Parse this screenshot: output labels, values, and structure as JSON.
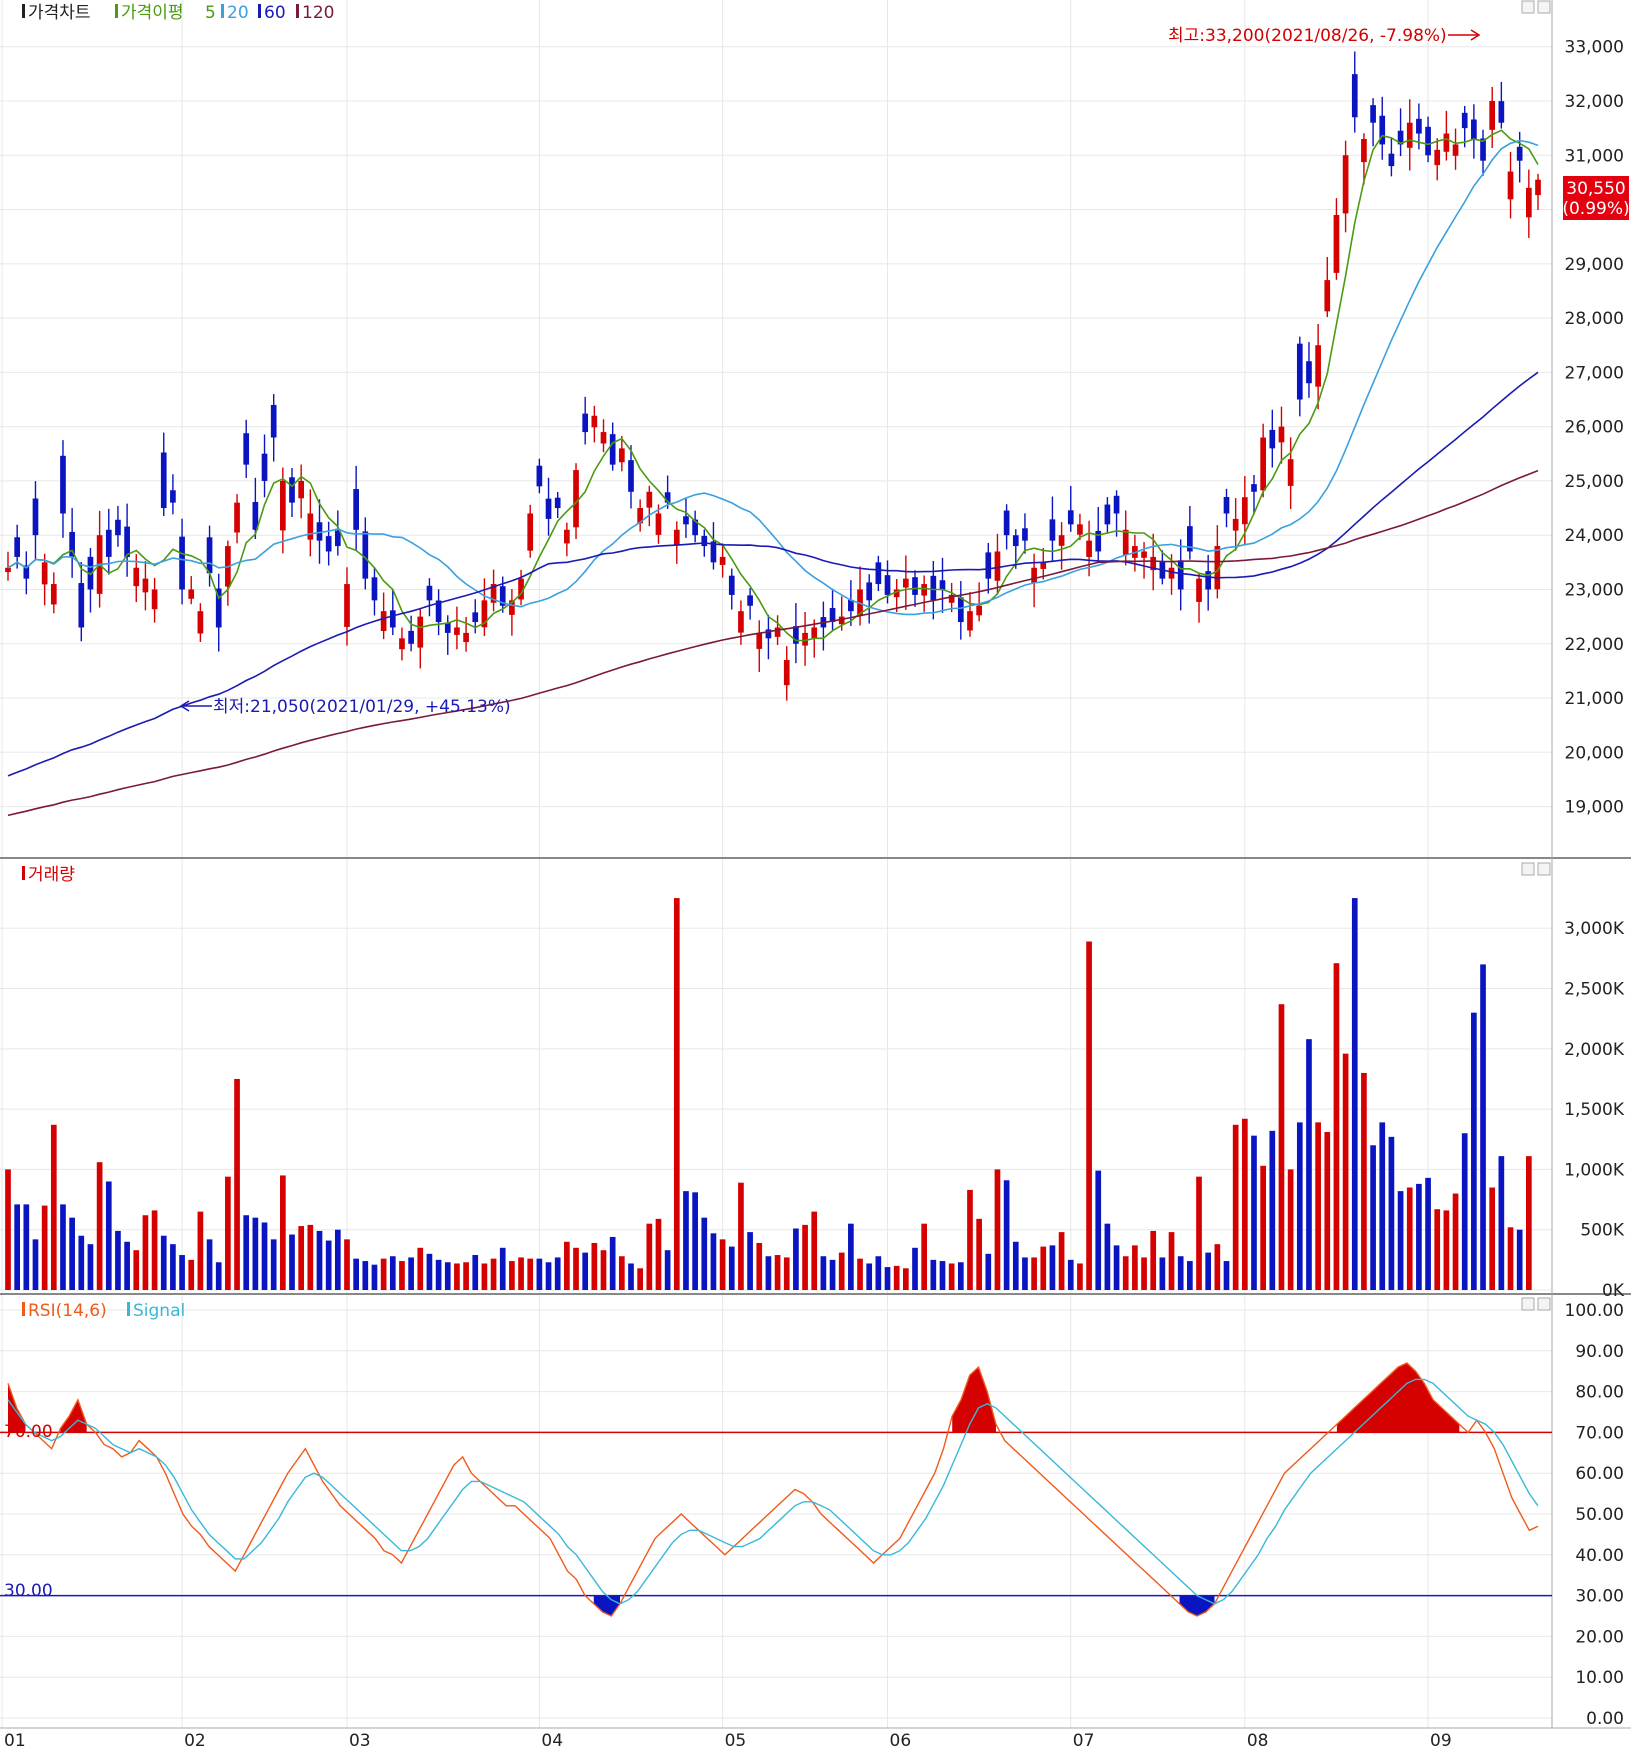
{
  "price_panel": {
    "legend": {
      "price_chart": "가격차트",
      "ma_label": "가격이평",
      "ma5": "5",
      "ma20": "20",
      "ma60": "60",
      "ma120": "120"
    },
    "annotations": {
      "high": "최고:33,200(2021/08/26, -7.98%)",
      "low": "최저:21,050(2021/01/29, +45.13%)"
    },
    "current_price": "30,550",
    "current_change": "(0.99%)"
  },
  "volume_panel": {
    "legend": "거래량"
  },
  "rsi_panel": {
    "legend": "RSI(14,6)",
    "signal_legend": "Signal",
    "upper_label": "70.00",
    "lower_label": "30.00"
  },
  "colors": {
    "up": "#d50000",
    "down": "#0a14c0",
    "ma5": "#4b9a12",
    "ma20": "#3aa0e0",
    "ma60": "#1a1ab4",
    "ma120": "#7a1a3a",
    "rsi": "#f05a1a",
    "signal": "#38b8d8"
  },
  "chart_data": [
    {
      "type": "candlestick",
      "title": "가격차트",
      "x_ticks": [
        "01",
        "02",
        "03",
        "04",
        "05",
        "06",
        "07",
        "08",
        "09"
      ],
      "y_ticks": [
        "19,000",
        "20,000",
        "21,000",
        "22,000",
        "23,000",
        "24,000",
        "25,000",
        "26,000",
        "27,000",
        "28,000",
        "29,000",
        "30,000",
        "31,000",
        "32,000",
        "33,000"
      ],
      "ylim": [
        18200,
        33400
      ],
      "high": 33200,
      "low": 21050,
      "close_last": 30550,
      "close": [
        23400,
        23600,
        23200,
        24000,
        23500,
        23100,
        24400,
        23600,
        22300,
        23000,
        24000,
        23600,
        24000,
        23600,
        23400,
        23200,
        23000,
        24500,
        24600,
        23000,
        23000,
        22600,
        23300,
        22300,
        23800,
        24600,
        25300,
        24100,
        25000,
        25800,
        25000,
        24600,
        25000,
        24400,
        23900,
        23700,
        23800,
        23100,
        24100,
        23200,
        22800,
        22600,
        22300,
        22100,
        22000,
        22500,
        22800,
        22400,
        22200,
        22300,
        22200,
        22400,
        22800,
        23100,
        22700,
        22800,
        23200,
        24400,
        24900,
        24300,
        24500,
        24100,
        25200,
        25900,
        26200,
        25900,
        25300,
        25600,
        24800,
        24500,
        24800,
        24400,
        24600,
        24100,
        24200,
        24000,
        23800,
        23500,
        23600,
        22900,
        22600,
        22700,
        22200,
        22100,
        22300,
        21700,
        22000,
        22200,
        22300,
        22300,
        22400,
        22500,
        22600,
        23000,
        22800,
        23100,
        22900,
        23000,
        23200,
        22900,
        23100,
        22800,
        23000,
        22900,
        22400,
        22600,
        22700,
        23200,
        23700,
        24000,
        23800,
        23900,
        23400,
        23500,
        23900,
        24000,
        24200,
        24200,
        23900,
        23700,
        24200,
        24400,
        24100,
        23800,
        23700,
        23600,
        23200,
        23400,
        23000,
        23700,
        23200,
        23000,
        23800,
        24400,
        24300,
        24700,
        24800,
        25800,
        25600,
        26000,
        25400,
        26500,
        26800,
        27500,
        28700,
        29900,
        31000,
        31700,
        31300,
        31600,
        31200,
        30800,
        31200,
        31600,
        31400,
        31000,
        31100,
        31400,
        31200,
        31500,
        31300,
        30900,
        32000,
        31600,
        30700,
        30900,
        30400,
        30550
      ],
      "ma_periods": [
        5,
        20,
        60,
        120
      ]
    },
    {
      "type": "bar",
      "title": "거래량",
      "y_ticks": [
        "0K",
        "500K",
        "1,000K",
        "1,500K",
        "2,000K",
        "2,500K",
        "3,000K"
      ],
      "ylim": [
        0,
        3400
      ],
      "unit": "K",
      "values": [
        1000,
        710,
        710,
        420,
        700,
        1370,
        710,
        600,
        450,
        380,
        1060,
        900,
        490,
        400,
        330,
        620,
        660,
        450,
        380,
        290,
        250,
        650,
        420,
        230,
        940,
        1750,
        620,
        600,
        560,
        420,
        950,
        460,
        530,
        540,
        490,
        410,
        500,
        420,
        260,
        240,
        210,
        260,
        280,
        240,
        270,
        350,
        300,
        250,
        230,
        220,
        230,
        290,
        220,
        260,
        350,
        240,
        270,
        260,
        260,
        230,
        270,
        400,
        350,
        310,
        390,
        330,
        440,
        280,
        220,
        180,
        550,
        590,
        330,
        3250,
        820,
        810,
        600,
        470,
        420,
        360,
        890,
        480,
        390,
        280,
        290,
        270,
        510,
        540,
        650,
        280,
        250,
        310,
        550,
        260,
        220,
        280,
        190,
        200,
        180,
        350,
        550,
        250,
        240,
        220,
        230,
        830,
        590,
        300,
        1000,
        910,
        400,
        270,
        270,
        360,
        370,
        480,
        250,
        220,
        2890,
        990,
        550,
        370,
        280,
        370,
        270,
        490,
        270,
        480,
        280,
        240,
        940,
        310,
        380,
        240,
        1370,
        1420,
        1280,
        1030,
        1320,
        2370,
        1000,
        1390,
        2080,
        1390,
        1310,
        2710,
        1960,
        3250,
        1800,
        1200,
        1390,
        1270,
        820,
        850,
        880,
        930,
        670,
        660,
        800,
        1300,
        2300,
        2700,
        850,
        1110,
        520,
        500,
        1110
      ],
      "up_mask": [
        1,
        0,
        0,
        0,
        1,
        1,
        0,
        0,
        0,
        0,
        1,
        0,
        0,
        0,
        1,
        1,
        1,
        0,
        0,
        0,
        1,
        1,
        0,
        0,
        1,
        1,
        0,
        0,
        0,
        0,
        1,
        0,
        1,
        1,
        0,
        0,
        0,
        1,
        0,
        0,
        0,
        1,
        0,
        1,
        0,
        1,
        0,
        0,
        0,
        1,
        1,
        0,
        1,
        1,
        0,
        1,
        1,
        1,
        0,
        0,
        0,
        1,
        1,
        0,
        1,
        1,
        0,
        1,
        0,
        1,
        1,
        1,
        0,
        1,
        0,
        0,
        0,
        0,
        1,
        0,
        1,
        0,
        1,
        0,
        1,
        1,
        0,
        1,
        1,
        0,
        0,
        1,
        0,
        1,
        0,
        0,
        0,
        1,
        1,
        0,
        1,
        0,
        0,
        1,
        0,
        1,
        1,
        0,
        1,
        0,
        0,
        0,
        1,
        1,
        0,
        1,
        0,
        1,
        1,
        0,
        0,
        0,
        1,
        1,
        1,
        1,
        0,
        1,
        0,
        0,
        1,
        0,
        1,
        0,
        1,
        1,
        0,
        1,
        0,
        1,
        1,
        0,
        0,
        1,
        1,
        1,
        1,
        0,
        1,
        0,
        0,
        0,
        0,
        1,
        0,
        0,
        1,
        1,
        1,
        0,
        0,
        0,
        1,
        0,
        1,
        0,
        1,
        1,
        0,
        1
      ]
    },
    {
      "type": "line",
      "title": "RSI(14,6)",
      "series": [
        {
          "name": "RSI(14,6)",
          "values": [
            82,
            76,
            72,
            70,
            68,
            66,
            71,
            74,
            78,
            72,
            70,
            67,
            66,
            64,
            65,
            68,
            66,
            64,
            60,
            55,
            50,
            47,
            45,
            42,
            40,
            38,
            36,
            40,
            44,
            48,
            52,
            56,
            60,
            63,
            66,
            62,
            58,
            55,
            52,
            50,
            48,
            46,
            44,
            41,
            40,
            38,
            42,
            46,
            50,
            54,
            58,
            62,
            64,
            60,
            58,
            56,
            54,
            52,
            52,
            50,
            48,
            46,
            44,
            40,
            36,
            34,
            30,
            28,
            26,
            25,
            28,
            32,
            36,
            40,
            44,
            46,
            48,
            50,
            48,
            46,
            44,
            42,
            40,
            42,
            44,
            46,
            48,
            50,
            52,
            54,
            56,
            55,
            53,
            50,
            48,
            46,
            44,
            42,
            40,
            38,
            40,
            42,
            44,
            48,
            52,
            56,
            60,
            66,
            74,
            78,
            84,
            86,
            80,
            72,
            68,
            66,
            64,
            62,
            60,
            58,
            56,
            54,
            52,
            50,
            48,
            46,
            44,
            42,
            40,
            38,
            36,
            34,
            32,
            30,
            28,
            26,
            25,
            26,
            28,
            32,
            36,
            40,
            44,
            48,
            52,
            56,
            60,
            62,
            64,
            66,
            68,
            70,
            72,
            74,
            76,
            78,
            80,
            82,
            84,
            86,
            87,
            85,
            82,
            78,
            76,
            74,
            72,
            70,
            73,
            70,
            66,
            60,
            54,
            50,
            46,
            47
          ]
        },
        {
          "name": "Signal",
          "values": [
            78,
            75,
            72,
            70,
            69,
            68,
            69,
            71,
            73,
            72,
            71,
            69,
            67,
            66,
            65,
            66,
            65,
            64,
            62,
            59,
            55,
            51,
            48,
            45,
            43,
            41,
            39,
            39,
            41,
            43,
            46,
            49,
            53,
            56,
            59,
            60,
            59,
            57,
            55,
            53,
            51,
            49,
            47,
            45,
            43,
            41,
            41,
            42,
            44,
            47,
            50,
            53,
            56,
            58,
            58,
            57,
            56,
            55,
            54,
            53,
            51,
            49,
            47,
            45,
            42,
            40,
            37,
            34,
            31,
            29,
            28,
            29,
            31,
            34,
            37,
            40,
            43,
            45,
            46,
            46,
            45,
            44,
            43,
            42,
            42,
            43,
            44,
            46,
            48,
            50,
            52,
            53,
            53,
            52,
            51,
            49,
            47,
            45,
            43,
            41,
            40,
            40,
            41,
            43,
            46,
            49,
            53,
            57,
            62,
            67,
            72,
            76,
            77,
            76,
            74,
            72,
            70,
            68,
            66,
            64,
            62,
            60,
            58,
            56,
            54,
            52,
            50,
            48,
            46,
            44,
            42,
            40,
            38,
            36,
            34,
            32,
            30,
            29,
            28,
            29,
            31,
            34,
            37,
            40,
            44,
            47,
            51,
            54,
            57,
            60,
            62,
            64,
            66,
            68,
            70,
            72,
            74,
            76,
            78,
            80,
            82,
            83,
            83,
            82,
            80,
            78,
            76,
            74,
            73,
            72,
            70,
            67,
            63,
            59,
            55,
            52
          ]
        }
      ],
      "y_ticks": [
        "0.00",
        "10.00",
        "20.00",
        "30.00",
        "40.00",
        "50.00",
        "60.00",
        "70.00",
        "80.00",
        "90.00",
        "100.00"
      ],
      "ylim": [
        0,
        100
      ],
      "reference_lines": [
        70,
        30
      ]
    }
  ]
}
